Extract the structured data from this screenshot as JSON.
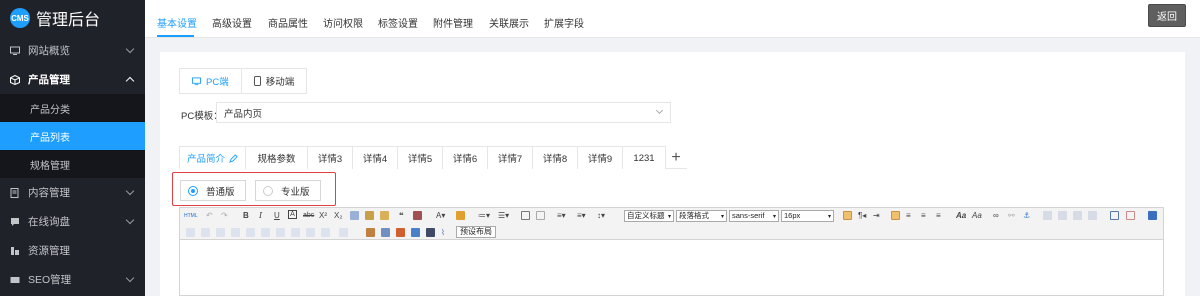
{
  "app": {
    "logo_badge": "CMS",
    "title": "管理后台"
  },
  "sidebar": {
    "items": [
      {
        "label": "网站概览",
        "icon": "monitor-icon"
      },
      {
        "label": "产品管理",
        "icon": "cube-icon",
        "open": true,
        "children": [
          {
            "label": "产品分类"
          },
          {
            "label": "产品列表",
            "active": true
          },
          {
            "label": "规格管理"
          }
        ]
      },
      {
        "label": "内容管理",
        "icon": "document-icon"
      },
      {
        "label": "在线询盘",
        "icon": "chat-icon"
      },
      {
        "label": "资源管理",
        "icon": "resource-icon"
      },
      {
        "label": "SEO管理",
        "icon": "seo-icon"
      }
    ]
  },
  "top_tabs": [
    "基本设置",
    "高级设置",
    "商品属性",
    "访问权限",
    "标签设置",
    "附件管理",
    "关联展示",
    "扩展字段"
  ],
  "back_button": "返回",
  "device_tabs": {
    "pc": "PC端",
    "mobile": "移动端"
  },
  "template": {
    "label": "PC模板：",
    "value": "产品内页"
  },
  "detail_tabs": [
    "产品简介",
    "规格参数",
    "详情3",
    "详情4",
    "详情5",
    "详情6",
    "详情7",
    "详情8",
    "详情9",
    "1231"
  ],
  "detail_add": "+",
  "edition": {
    "standard": "普通版",
    "pro": "专业版"
  },
  "editor": {
    "html_btn": "HTML",
    "heading_select": "自定义标题",
    "paragraph_select": "段落格式",
    "font_select": "sans-serif",
    "size_select": "16px",
    "preset_button": "预设布局"
  },
  "colors": {
    "accent": "#1e9fff",
    "sidebar": "#20222a",
    "highlight_border": "#e04040"
  }
}
